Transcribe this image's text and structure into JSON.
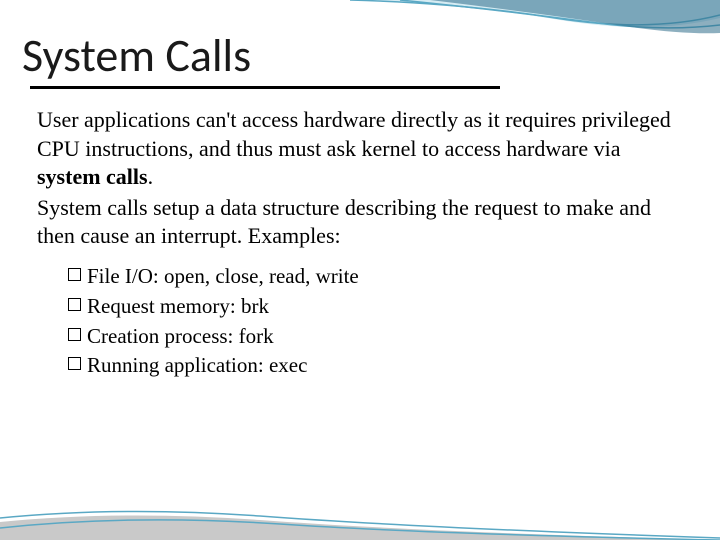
{
  "title": "System Calls",
  "paragraphs": {
    "p1_a": "User applications can't access hardware directly as it requires privileged CPU instructions, and thus must ask kernel to access hardware via ",
    "p1_bold": "system calls",
    "p1_b": ".",
    "p2": "System calls setup a data structure describing the request to make and then cause an interrupt. Examples:"
  },
  "list": [
    "File I/O: open, close, read, write",
    "Request memory: brk",
    "Creation process: fork",
    "Running application: exec"
  ],
  "decor": {
    "top_stroke": "#5aa8c4",
    "top_fill_dark": "#2f6e8a",
    "top_fill_light": "#d6ecf3",
    "bottom_stroke": "#5aa8c4",
    "bottom_fill": "#c9c9c9"
  }
}
